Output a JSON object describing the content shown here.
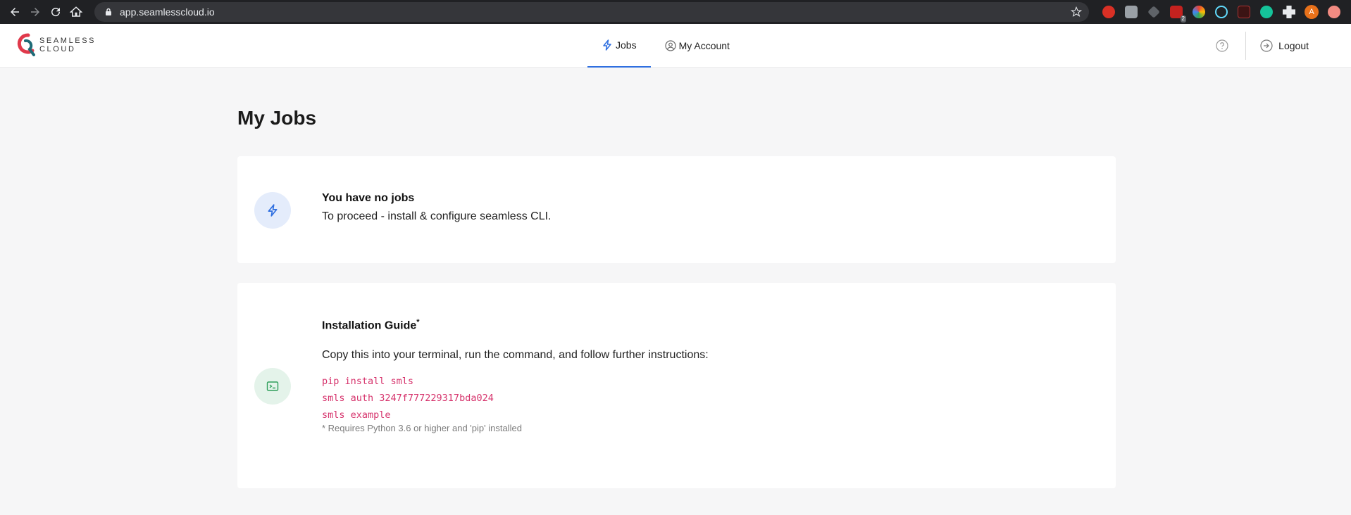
{
  "browser": {
    "url": "app.seamlesscloud.io",
    "extension_badge": "2",
    "profile_initial": "A"
  },
  "logo": {
    "line1": "SEAMLESS",
    "line2": "CLOUD"
  },
  "nav": {
    "tabs": [
      {
        "label": "Jobs",
        "icon": "bolt-icon",
        "active": true
      },
      {
        "label": "My Account",
        "icon": "user-circle-icon",
        "active": false
      }
    ],
    "logout_label": "Logout"
  },
  "page": {
    "title": "My Jobs"
  },
  "empty_state": {
    "heading": "You have no jobs",
    "text": "To proceed - install & configure seamless CLI."
  },
  "install_guide": {
    "heading": "Installation Guide",
    "heading_mark": "*",
    "instructions": "Copy this into your terminal, run the command, and follow further instructions:",
    "commands": [
      "pip install smls",
      "smls auth 3247f777229317bda024",
      "smls example"
    ],
    "note": "* Requires Python 3.6 or higher and 'pip' installed"
  },
  "colors": {
    "accent": "#2f6fe0",
    "code": "#d6336c",
    "terminal_icon": "#2e9e5b"
  }
}
